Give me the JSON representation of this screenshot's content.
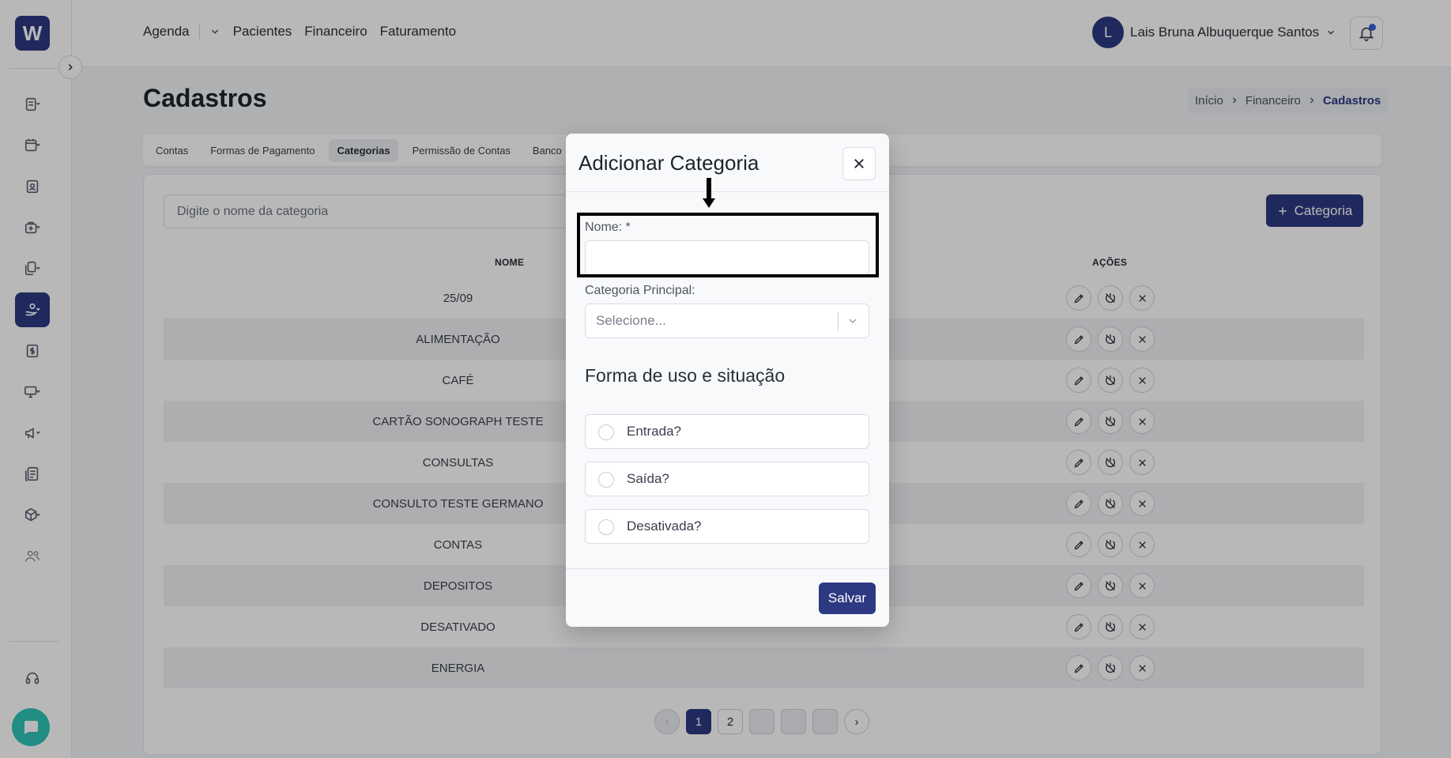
{
  "brand": {
    "logo_text": "W",
    "accent": "#2d3a82"
  },
  "topnav": {
    "items": [
      "Agenda",
      "Pacientes",
      "Financeiro",
      "Faturamento"
    ],
    "user_initial": "L",
    "user_name": "Lais Bruna Albuquerque Santos"
  },
  "page": {
    "title": "Cadastros",
    "breadcrumb": [
      "Início",
      "Financeiro",
      "Cadastros"
    ]
  },
  "tabs": [
    "Contas",
    "Formas de Pagamento",
    "Categorias",
    "Permissão de Contas",
    "Banco"
  ],
  "active_tab": "Categorias",
  "list": {
    "search_placeholder": "Digite o nome da categoria",
    "add_button_label": "Categoria",
    "col_name": "NOME",
    "col_actions": "AÇÕES",
    "rows": [
      "25/09",
      "ALIMENTAÇÃO",
      "CAFÉ",
      "CARTÃO SONOGRAPH TESTE",
      "CONSULTAS",
      "CONSULTO TESTE GERMANO",
      "CONTAS",
      "DEPOSITOS",
      "DESATIVADO",
      "ENERGIA"
    ]
  },
  "pagination": {
    "prev": "‹",
    "pages": [
      "1",
      "2",
      "",
      "",
      ""
    ],
    "next": "›",
    "current": "1"
  },
  "modal": {
    "title": "Adicionar Categoria",
    "name_label": "Nome: *",
    "name_value": "",
    "parent_label": "Categoria Principal:",
    "parent_placeholder": "Selecione...",
    "section_title": "Forma de uso e situação",
    "checks": [
      "Entrada?",
      "Saída?",
      "Desativada?"
    ],
    "save_label": "Salvar"
  }
}
